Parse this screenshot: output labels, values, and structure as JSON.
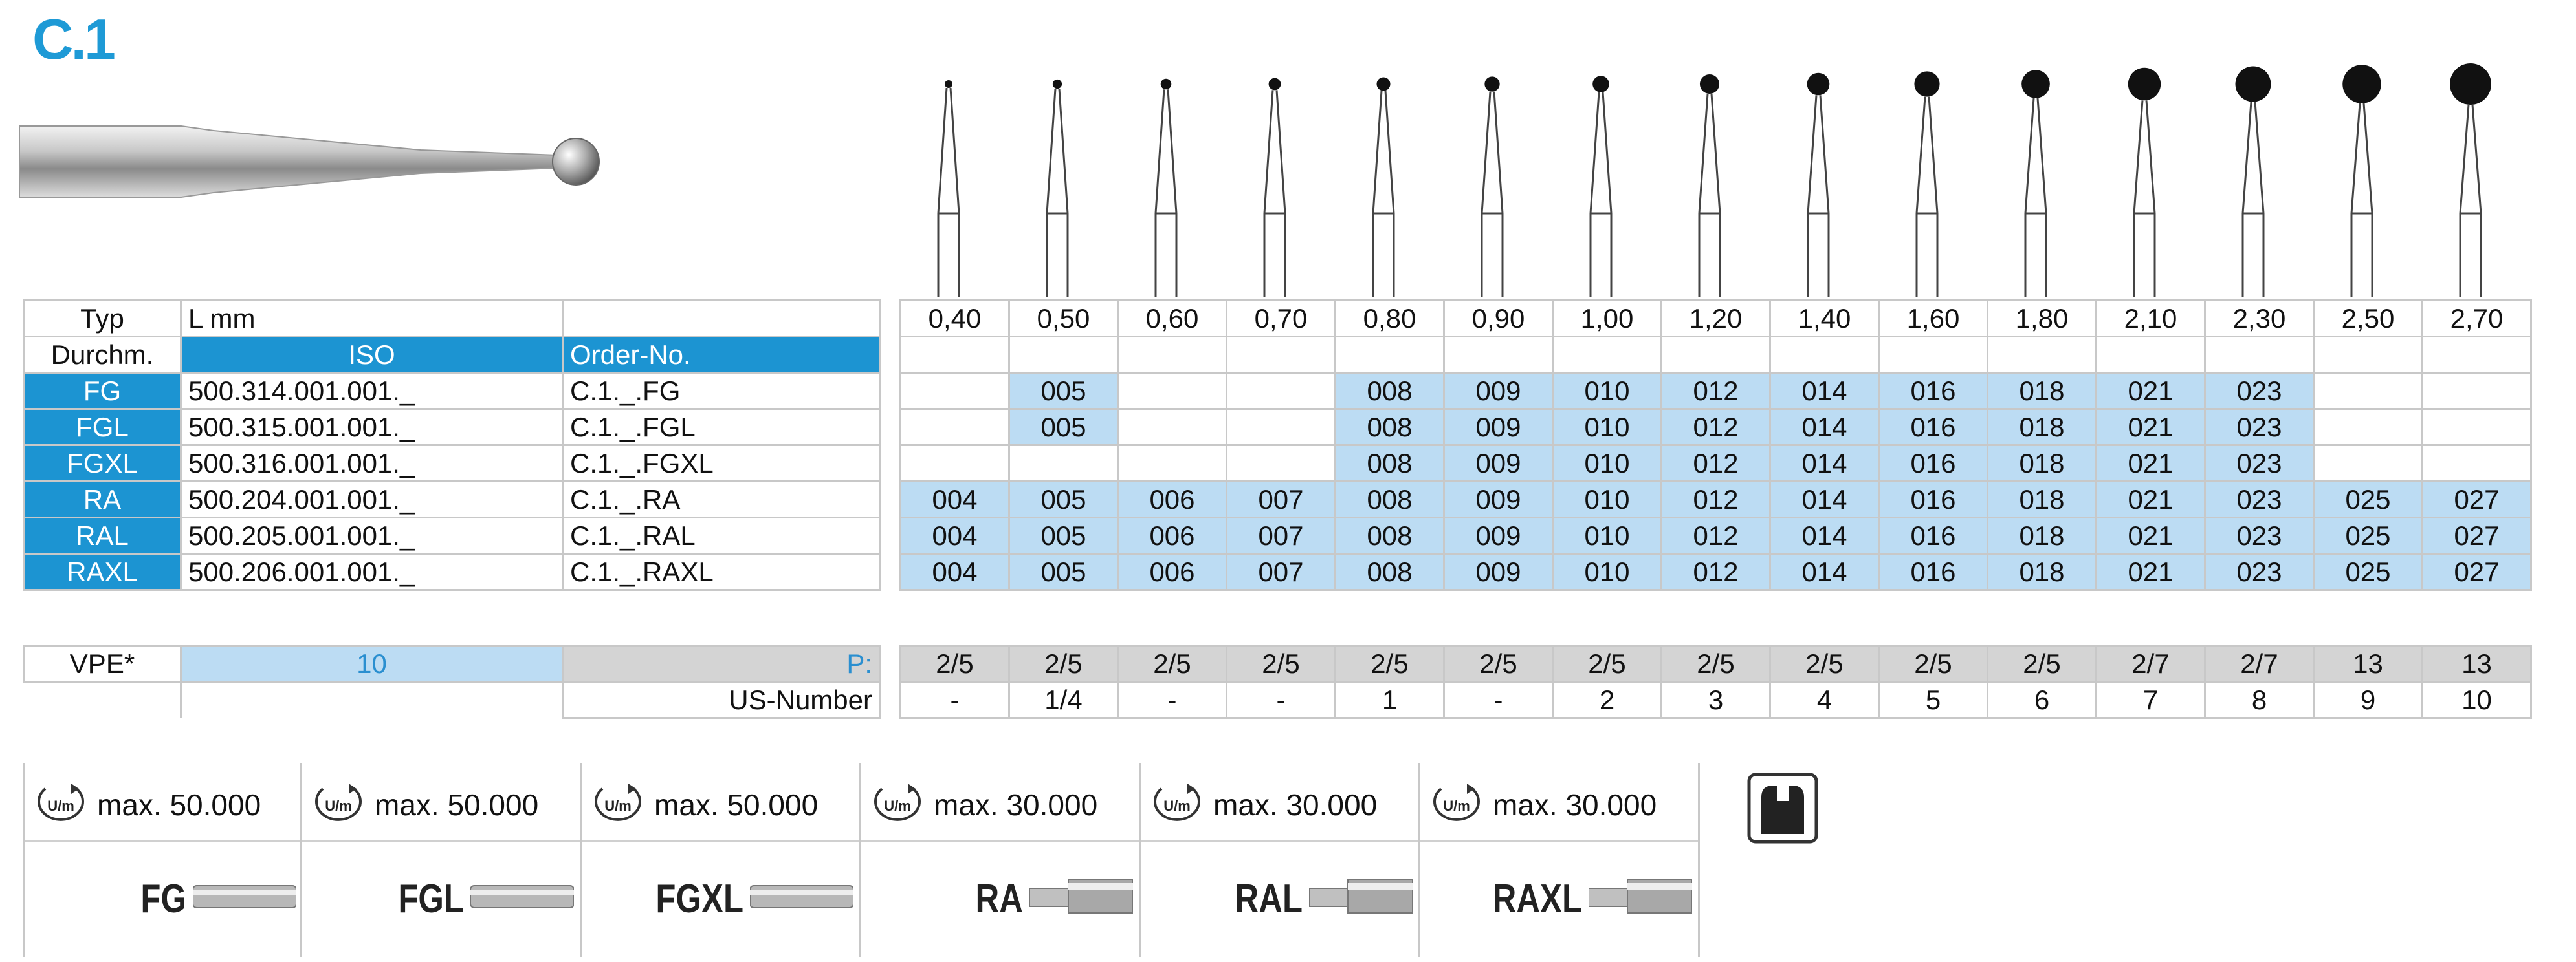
{
  "title": "C.1",
  "header": {
    "typ": "Typ",
    "lmm": "L mm",
    "durchm": "Durchm.",
    "iso": "ISO",
    "order": "Order-No."
  },
  "sizes": [
    "0,40",
    "0,50",
    "0,60",
    "0,70",
    "0,80",
    "0,90",
    "1,00",
    "1,20",
    "1,40",
    "1,60",
    "1,80",
    "2,10",
    "2,30",
    "2,50",
    "2,70"
  ],
  "rows": [
    {
      "type": "FG",
      "iso": "500.314.001.001._",
      "order": "C.1._.FG",
      "codes": [
        "",
        "005",
        "",
        "",
        "008",
        "009",
        "010",
        "012",
        "014",
        "016",
        "018",
        "021",
        "023",
        "",
        ""
      ]
    },
    {
      "type": "FGL",
      "iso": "500.315.001.001._",
      "order": "C.1._.FGL",
      "codes": [
        "",
        "005",
        "",
        "",
        "008",
        "009",
        "010",
        "012",
        "014",
        "016",
        "018",
        "021",
        "023",
        "",
        ""
      ]
    },
    {
      "type": "FGXL",
      "iso": "500.316.001.001._",
      "order": "C.1._.FGXL",
      "codes": [
        "",
        "",
        "",
        "",
        "008",
        "009",
        "010",
        "012",
        "014",
        "016",
        "018",
        "021",
        "023",
        "",
        ""
      ]
    },
    {
      "type": "RA",
      "iso": "500.204.001.001._",
      "order": "C.1._.RA",
      "codes": [
        "004",
        "005",
        "006",
        "007",
        "008",
        "009",
        "010",
        "012",
        "014",
        "016",
        "018",
        "021",
        "023",
        "025",
        "027"
      ]
    },
    {
      "type": "RAL",
      "iso": "500.205.001.001._",
      "order": "C.1._.RAL",
      "codes": [
        "004",
        "005",
        "006",
        "007",
        "008",
        "009",
        "010",
        "012",
        "014",
        "016",
        "018",
        "021",
        "023",
        "025",
        "027"
      ]
    },
    {
      "type": "RAXL",
      "iso": "500.206.001.001._",
      "order": "C.1._.RAXL",
      "codes": [
        "004",
        "005",
        "006",
        "007",
        "008",
        "009",
        "010",
        "012",
        "014",
        "016",
        "018",
        "021",
        "023",
        "025",
        "027"
      ]
    }
  ],
  "vpe": {
    "label": "VPE*",
    "value": "10",
    "p_label": "P:",
    "us_label": "US-Number",
    "packs": [
      "2/5",
      "2/5",
      "2/5",
      "2/5",
      "2/5",
      "2/5",
      "2/5",
      "2/5",
      "2/5",
      "2/5",
      "2/5",
      "2/7",
      "2/7",
      "13",
      "13"
    ],
    "us_numbers": [
      "-",
      "1/4",
      "-",
      "-",
      "1",
      "-",
      "2",
      "3",
      "4",
      "5",
      "6",
      "7",
      "8",
      "9",
      "10"
    ]
  },
  "speeds": [
    {
      "rpm_unit": "U/m",
      "max": "max. 50.000",
      "shank": "FG"
    },
    {
      "rpm_unit": "U/m",
      "max": "max. 50.000",
      "shank": "FGL"
    },
    {
      "rpm_unit": "U/m",
      "max": "max. 50.000",
      "shank": "FGXL"
    },
    {
      "rpm_unit": "U/m",
      "max": "max. 30.000",
      "shank": "RA"
    },
    {
      "rpm_unit": "U/m",
      "max": "max. 30.000",
      "shank": "RAL"
    },
    {
      "rpm_unit": "U/m",
      "max": "max. 30.000",
      "shank": "RAXL"
    }
  ],
  "colors": {
    "accent": "#1c94d2",
    "light": "#bcdcf3",
    "gray": "#d4d4d4",
    "title": "#1e9ad6"
  }
}
